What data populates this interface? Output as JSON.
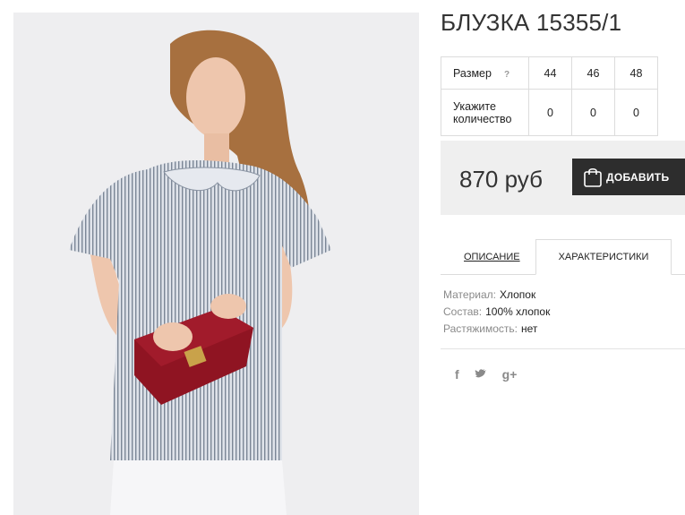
{
  "product": {
    "title": "БЛУЗКА 15355/1",
    "image_alt": "model wearing striped blouse with red handbag"
  },
  "sizes": {
    "row_label": "Размер",
    "help_icon": "?",
    "values": [
      "44",
      "46",
      "48"
    ],
    "qty_label": "Укажите количество",
    "quantities": [
      "0",
      "0",
      "0"
    ]
  },
  "purchase": {
    "price": "870 руб",
    "add_label": "ДОБАВИТЬ",
    "icon": "shopping-bag-icon"
  },
  "tabs": {
    "description": "ОПИСАНИЕ",
    "specs": "ХАРАКТЕРИСТИКИ",
    "active": "specs"
  },
  "specs": [
    {
      "label": "Материал:",
      "value": "Хлопок"
    },
    {
      "label": "Состав:",
      "value": "100% хлопок"
    },
    {
      "label": "Растяжимость:",
      "value": "нет"
    }
  ],
  "social": {
    "facebook": "f",
    "twitter": "t",
    "googleplus": "g+"
  },
  "colors": {
    "accent_dark": "#2d2d2d",
    "price_panel": "#efefef",
    "photo_bg": "#eeeef0"
  }
}
